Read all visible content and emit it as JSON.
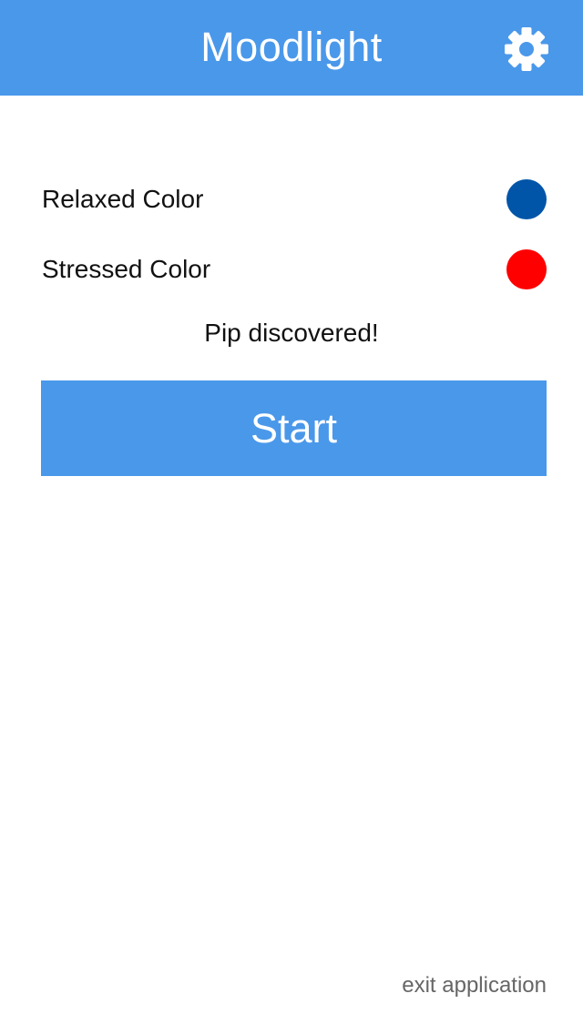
{
  "header": {
    "title": "Moodlight",
    "background_color": "#4a98ea",
    "settings_icon": "gear-icon"
  },
  "colors": {
    "relaxed": {
      "label": "Relaxed Color",
      "value": "#0055a8"
    },
    "stressed": {
      "label": "Stressed Color",
      "value": "#ff0000"
    }
  },
  "status": {
    "text": "Pip discovered!"
  },
  "start_button": {
    "label": "Start",
    "color": "#4a98ea"
  },
  "footer": {
    "exit_label": "exit application"
  }
}
